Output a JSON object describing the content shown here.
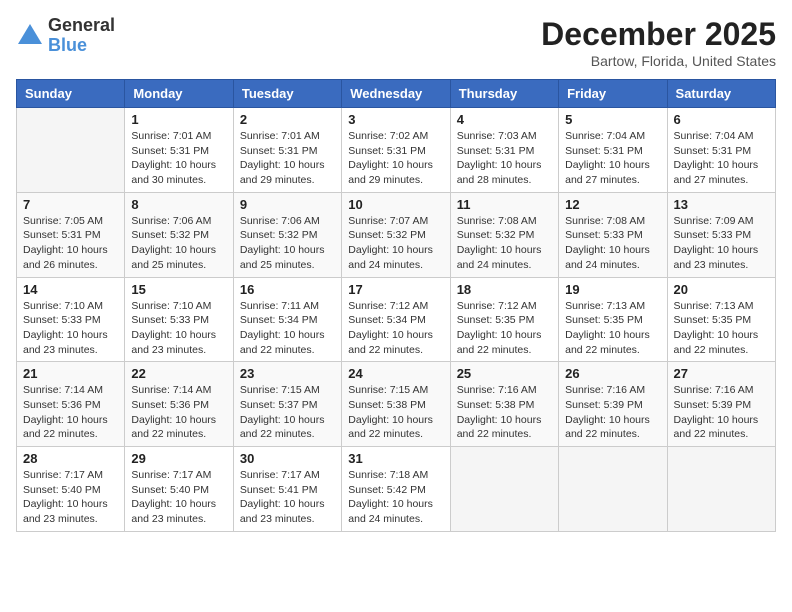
{
  "logo": {
    "general": "General",
    "blue": "Blue"
  },
  "title": "December 2025",
  "location": "Bartow, Florida, United States",
  "days_of_week": [
    "Sunday",
    "Monday",
    "Tuesday",
    "Wednesday",
    "Thursday",
    "Friday",
    "Saturday"
  ],
  "weeks": [
    [
      {
        "day": "",
        "info": ""
      },
      {
        "day": "1",
        "info": "Sunrise: 7:01 AM\nSunset: 5:31 PM\nDaylight: 10 hours\nand 30 minutes."
      },
      {
        "day": "2",
        "info": "Sunrise: 7:01 AM\nSunset: 5:31 PM\nDaylight: 10 hours\nand 29 minutes."
      },
      {
        "day": "3",
        "info": "Sunrise: 7:02 AM\nSunset: 5:31 PM\nDaylight: 10 hours\nand 29 minutes."
      },
      {
        "day": "4",
        "info": "Sunrise: 7:03 AM\nSunset: 5:31 PM\nDaylight: 10 hours\nand 28 minutes."
      },
      {
        "day": "5",
        "info": "Sunrise: 7:04 AM\nSunset: 5:31 PM\nDaylight: 10 hours\nand 27 minutes."
      },
      {
        "day": "6",
        "info": "Sunrise: 7:04 AM\nSunset: 5:31 PM\nDaylight: 10 hours\nand 27 minutes."
      }
    ],
    [
      {
        "day": "7",
        "info": "Sunrise: 7:05 AM\nSunset: 5:31 PM\nDaylight: 10 hours\nand 26 minutes."
      },
      {
        "day": "8",
        "info": "Sunrise: 7:06 AM\nSunset: 5:32 PM\nDaylight: 10 hours\nand 25 minutes."
      },
      {
        "day": "9",
        "info": "Sunrise: 7:06 AM\nSunset: 5:32 PM\nDaylight: 10 hours\nand 25 minutes."
      },
      {
        "day": "10",
        "info": "Sunrise: 7:07 AM\nSunset: 5:32 PM\nDaylight: 10 hours\nand 24 minutes."
      },
      {
        "day": "11",
        "info": "Sunrise: 7:08 AM\nSunset: 5:32 PM\nDaylight: 10 hours\nand 24 minutes."
      },
      {
        "day": "12",
        "info": "Sunrise: 7:08 AM\nSunset: 5:33 PM\nDaylight: 10 hours\nand 24 minutes."
      },
      {
        "day": "13",
        "info": "Sunrise: 7:09 AM\nSunset: 5:33 PM\nDaylight: 10 hours\nand 23 minutes."
      }
    ],
    [
      {
        "day": "14",
        "info": "Sunrise: 7:10 AM\nSunset: 5:33 PM\nDaylight: 10 hours\nand 23 minutes."
      },
      {
        "day": "15",
        "info": "Sunrise: 7:10 AM\nSunset: 5:33 PM\nDaylight: 10 hours\nand 23 minutes."
      },
      {
        "day": "16",
        "info": "Sunrise: 7:11 AM\nSunset: 5:34 PM\nDaylight: 10 hours\nand 22 minutes."
      },
      {
        "day": "17",
        "info": "Sunrise: 7:12 AM\nSunset: 5:34 PM\nDaylight: 10 hours\nand 22 minutes."
      },
      {
        "day": "18",
        "info": "Sunrise: 7:12 AM\nSunset: 5:35 PM\nDaylight: 10 hours\nand 22 minutes."
      },
      {
        "day": "19",
        "info": "Sunrise: 7:13 AM\nSunset: 5:35 PM\nDaylight: 10 hours\nand 22 minutes."
      },
      {
        "day": "20",
        "info": "Sunrise: 7:13 AM\nSunset: 5:35 PM\nDaylight: 10 hours\nand 22 minutes."
      }
    ],
    [
      {
        "day": "21",
        "info": "Sunrise: 7:14 AM\nSunset: 5:36 PM\nDaylight: 10 hours\nand 22 minutes."
      },
      {
        "day": "22",
        "info": "Sunrise: 7:14 AM\nSunset: 5:36 PM\nDaylight: 10 hours\nand 22 minutes."
      },
      {
        "day": "23",
        "info": "Sunrise: 7:15 AM\nSunset: 5:37 PM\nDaylight: 10 hours\nand 22 minutes."
      },
      {
        "day": "24",
        "info": "Sunrise: 7:15 AM\nSunset: 5:38 PM\nDaylight: 10 hours\nand 22 minutes."
      },
      {
        "day": "25",
        "info": "Sunrise: 7:16 AM\nSunset: 5:38 PM\nDaylight: 10 hours\nand 22 minutes."
      },
      {
        "day": "26",
        "info": "Sunrise: 7:16 AM\nSunset: 5:39 PM\nDaylight: 10 hours\nand 22 minutes."
      },
      {
        "day": "27",
        "info": "Sunrise: 7:16 AM\nSunset: 5:39 PM\nDaylight: 10 hours\nand 22 minutes."
      }
    ],
    [
      {
        "day": "28",
        "info": "Sunrise: 7:17 AM\nSunset: 5:40 PM\nDaylight: 10 hours\nand 23 minutes."
      },
      {
        "day": "29",
        "info": "Sunrise: 7:17 AM\nSunset: 5:40 PM\nDaylight: 10 hours\nand 23 minutes."
      },
      {
        "day": "30",
        "info": "Sunrise: 7:17 AM\nSunset: 5:41 PM\nDaylight: 10 hours\nand 23 minutes."
      },
      {
        "day": "31",
        "info": "Sunrise: 7:18 AM\nSunset: 5:42 PM\nDaylight: 10 hours\nand 24 minutes."
      },
      {
        "day": "",
        "info": ""
      },
      {
        "day": "",
        "info": ""
      },
      {
        "day": "",
        "info": ""
      }
    ]
  ]
}
